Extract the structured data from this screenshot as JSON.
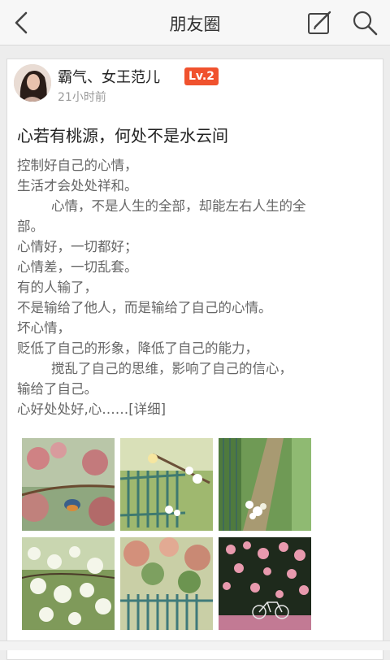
{
  "header": {
    "title": "朋友圈",
    "back_icon": "chevron-left-icon",
    "edit_icon": "compose-icon",
    "search_icon": "search-icon"
  },
  "post": {
    "username": "霸气、女王范儿",
    "level_badge": "Lv.2",
    "time": "21小时前",
    "title": "心若有桃源，何处不是水云间",
    "body_lines": [
      "控制好自己的心情，",
      "生活才会处处祥和。",
      "        心情，不是人生的全部，却能左右人生的全",
      "部。",
      "心情好，一切都好；",
      "心情差，一切乱套。",
      "有的人输了，",
      "不是输给了他人，而是输给了自己的心情。",
      "坏心情，",
      "贬低了自己的形象，降低了自己的能力，",
      "        搅乱了自己的思维，影响了自己的信心，",
      "输给了自己。"
    ],
    "last_line": "心好处处好,心……",
    "more_link": "[详细]",
    "colors": {
      "badge": "#f0522e",
      "title": "#222222",
      "body": "#666666"
    }
  }
}
